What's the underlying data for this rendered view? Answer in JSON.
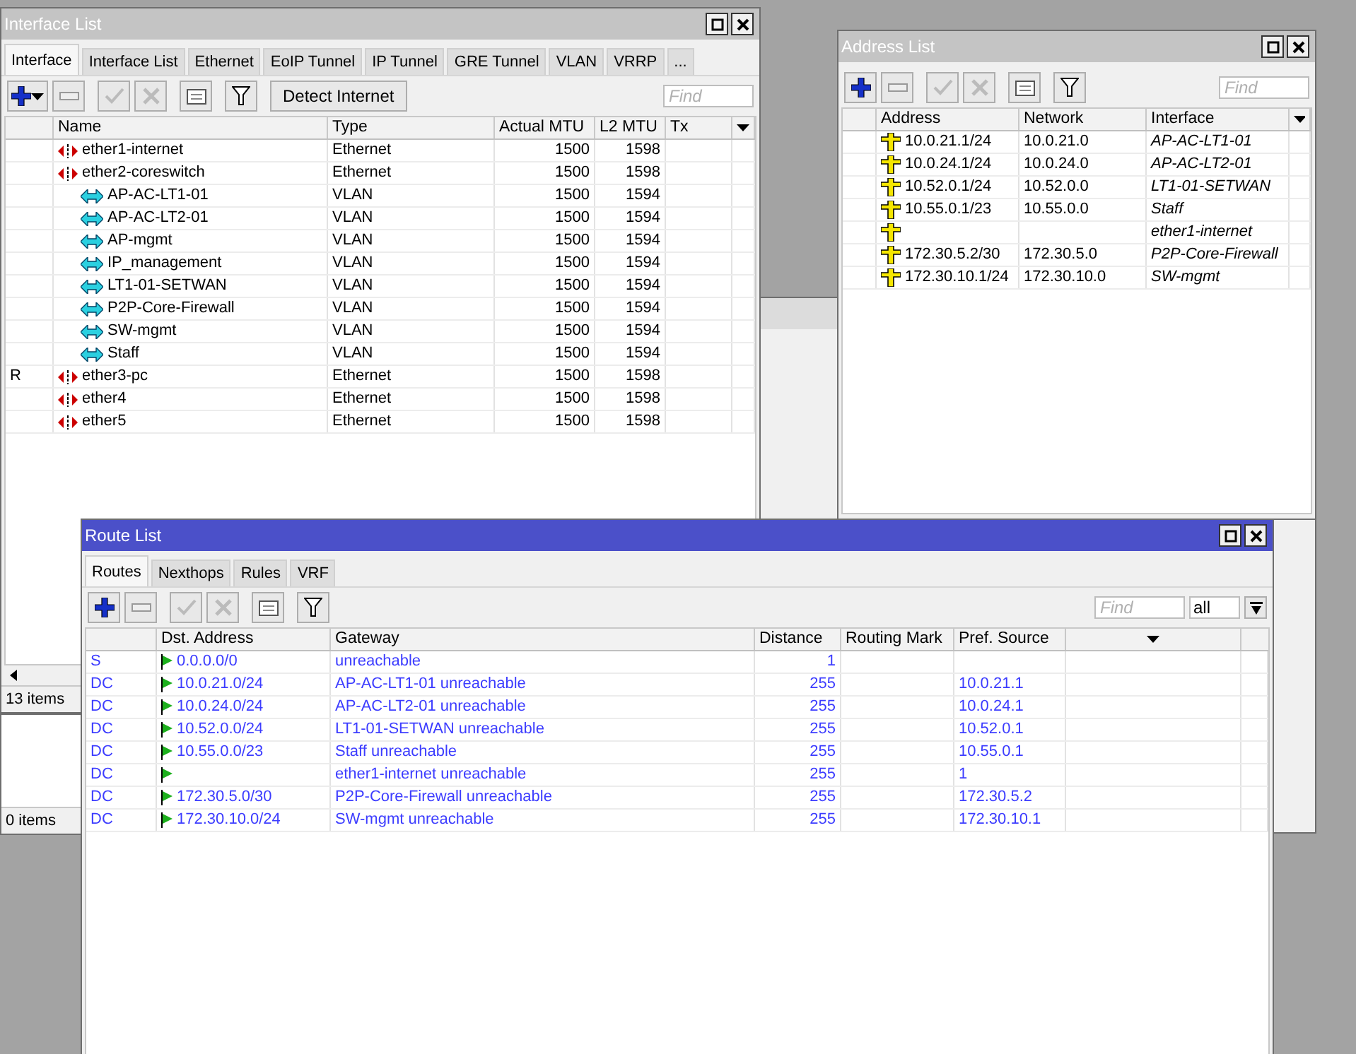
{
  "interface_window": {
    "title": "Interface List",
    "active": false,
    "tabs": [
      {
        "label": "Interface",
        "selected": true
      },
      {
        "label": "Interface List",
        "selected": false
      },
      {
        "label": "Ethernet",
        "selected": false
      },
      {
        "label": "EoIP Tunnel",
        "selected": false
      },
      {
        "label": "IP Tunnel",
        "selected": false
      },
      {
        "label": "GRE Tunnel",
        "selected": false
      },
      {
        "label": "VLAN",
        "selected": false
      },
      {
        "label": "VRRP",
        "selected": false
      },
      {
        "label": "...",
        "selected": false
      }
    ],
    "detect_button": "Detect Internet",
    "find_placeholder": "Find",
    "columns": [
      "Name",
      "Type",
      "Actual MTU",
      "L2 MTU",
      "Tx"
    ],
    "rows": [
      {
        "kind": "ethernet",
        "name": "ether1-internet",
        "type": "Ethernet",
        "actual_mtu": "1500",
        "l2_mtu": "1598"
      },
      {
        "kind": "ethernet",
        "name": "ether2-coreswitch",
        "type": "Ethernet",
        "actual_mtu": "1500",
        "l2_mtu": "1598",
        "children": [
          {
            "kind": "vlan",
            "name": "AP-AC-LT1-01",
            "type": "VLAN",
            "actual_mtu": "1500",
            "l2_mtu": "1594"
          },
          {
            "kind": "vlan",
            "name": "AP-AC-LT2-01",
            "type": "VLAN",
            "actual_mtu": "1500",
            "l2_mtu": "1594"
          },
          {
            "kind": "vlan",
            "name": "AP-mgmt",
            "type": "VLAN",
            "actual_mtu": "1500",
            "l2_mtu": "1594"
          },
          {
            "kind": "vlan",
            "name": "IP_management",
            "type": "VLAN",
            "actual_mtu": "1500",
            "l2_mtu": "1594"
          },
          {
            "kind": "vlan",
            "name": "LT1-01-SETWAN",
            "type": "VLAN",
            "actual_mtu": "1500",
            "l2_mtu": "1594"
          },
          {
            "kind": "vlan",
            "name": "P2P-Core-Firewall",
            "type": "VLAN",
            "actual_mtu": "1500",
            "l2_mtu": "1594"
          },
          {
            "kind": "vlan",
            "name": "SW-mgmt",
            "type": "VLAN",
            "actual_mtu": "1500",
            "l2_mtu": "1594"
          },
          {
            "kind": "vlan",
            "name": "Staff",
            "type": "VLAN",
            "actual_mtu": "1500",
            "l2_mtu": "1594"
          }
        ]
      },
      {
        "kind": "ethernet",
        "flag": "R",
        "name": "ether3-pc",
        "type": "Ethernet",
        "actual_mtu": "1500",
        "l2_mtu": "1598"
      },
      {
        "kind": "ethernet",
        "name": "ether4",
        "type": "Ethernet",
        "actual_mtu": "1500",
        "l2_mtu": "1598"
      },
      {
        "kind": "ethernet",
        "name": "ether5",
        "type": "Ethernet",
        "actual_mtu": "1500",
        "l2_mtu": "1598"
      }
    ],
    "status": "13 items"
  },
  "lower_window": {
    "status": "0 items"
  },
  "address_window": {
    "title": "Address List",
    "active": false,
    "find_placeholder": "Find",
    "columns": [
      "Address",
      "Network",
      "Interface"
    ],
    "rows": [
      {
        "address": "10.0.21.1/24",
        "network": "10.0.21.0",
        "interface": "AP-AC-LT1-01"
      },
      {
        "address": "10.0.24.1/24",
        "network": "10.0.24.0",
        "interface": "AP-AC-LT2-01"
      },
      {
        "address": "10.52.0.1/24",
        "network": "10.52.0.0",
        "interface": "LT1-01-SETWAN"
      },
      {
        "address": "10.55.0.1/23",
        "network": "10.55.0.0",
        "interface": "Staff"
      },
      {
        "interface": "ether1-internet"
      },
      {
        "address": "172.30.5.2/30",
        "network": "172.30.5.0",
        "interface": "P2P-Core-Firewall"
      },
      {
        "address": "172.30.10.1/24",
        "network": "172.30.10.0",
        "interface": "SW-mgmt"
      }
    ]
  },
  "route_window": {
    "title": "Route List",
    "active": true,
    "tabs": [
      {
        "label": "Routes",
        "selected": true
      },
      {
        "label": "Nexthops",
        "selected": false
      },
      {
        "label": "Rules",
        "selected": false
      },
      {
        "label": "VRF",
        "selected": false
      }
    ],
    "find_placeholder": "Find",
    "filter_value": "all",
    "columns": [
      "Dst. Address",
      "Gateway",
      "Distance",
      "Routing Mark",
      "Pref. Source"
    ],
    "rows": [
      {
        "flags": "S",
        "dst": "0.0.0.0/0",
        "gateway": "unreachable",
        "distance": "1"
      },
      {
        "flags": "DC",
        "dst": "10.0.21.0/24",
        "gateway": "AP-AC-LT1-01 unreachable",
        "distance": "255",
        "pref_source": "10.0.21.1"
      },
      {
        "flags": "DC",
        "dst": "10.0.24.0/24",
        "gateway": "AP-AC-LT2-01 unreachable",
        "distance": "255",
        "pref_source": "10.0.24.1"
      },
      {
        "flags": "DC",
        "dst": "10.52.0.0/24",
        "gateway": "LT1-01-SETWAN unreachable",
        "distance": "255",
        "pref_source": "10.52.0.1"
      },
      {
        "flags": "DC",
        "dst": "10.55.0.0/23",
        "gateway": "Staff unreachable",
        "distance": "255",
        "pref_source": "10.55.0.1"
      },
      {
        "flags": "DC",
        "gateway": "ether1-internet unreachable",
        "distance": "255",
        "pref_source": "1"
      },
      {
        "flags": "DC",
        "dst": "172.30.5.0/30",
        "gateway": "P2P-Core-Firewall unreachable",
        "distance": "255",
        "pref_source": "172.30.5.2"
      },
      {
        "flags": "DC",
        "dst": "172.30.10.0/24",
        "gateway": "SW-mgmt unreachable",
        "distance": "255",
        "pref_source": "172.30.10.1"
      }
    ]
  }
}
